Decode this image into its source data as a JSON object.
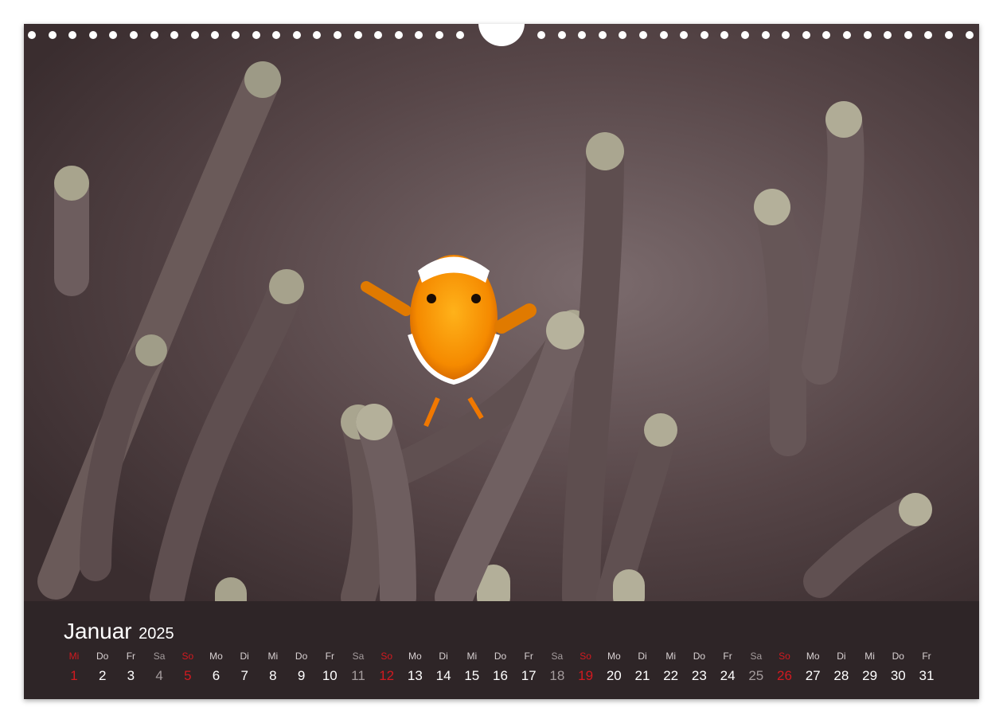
{
  "calendar": {
    "month": "Januar",
    "year": "2025",
    "photo_subject": "clownfish-in-anemone",
    "colors": {
      "bar": "#2e2527",
      "weekday": "#ffffff",
      "saturday": "#a49c9d",
      "sunday": "#d11a20"
    },
    "days": [
      {
        "wd": "Mi",
        "d": "1",
        "type": "sun"
      },
      {
        "wd": "Do",
        "d": "2",
        "type": "wk"
      },
      {
        "wd": "Fr",
        "d": "3",
        "type": "wk"
      },
      {
        "wd": "Sa",
        "d": "4",
        "type": "sat"
      },
      {
        "wd": "So",
        "d": "5",
        "type": "sun"
      },
      {
        "wd": "Mo",
        "d": "6",
        "type": "wk"
      },
      {
        "wd": "Di",
        "d": "7",
        "type": "wk"
      },
      {
        "wd": "Mi",
        "d": "8",
        "type": "wk"
      },
      {
        "wd": "Do",
        "d": "9",
        "type": "wk"
      },
      {
        "wd": "Fr",
        "d": "10",
        "type": "wk"
      },
      {
        "wd": "Sa",
        "d": "11",
        "type": "sat"
      },
      {
        "wd": "So",
        "d": "12",
        "type": "sun"
      },
      {
        "wd": "Mo",
        "d": "13",
        "type": "wk"
      },
      {
        "wd": "Di",
        "d": "14",
        "type": "wk"
      },
      {
        "wd": "Mi",
        "d": "15",
        "type": "wk"
      },
      {
        "wd": "Do",
        "d": "16",
        "type": "wk"
      },
      {
        "wd": "Fr",
        "d": "17",
        "type": "wk"
      },
      {
        "wd": "Sa",
        "d": "18",
        "type": "sat"
      },
      {
        "wd": "So",
        "d": "19",
        "type": "sun"
      },
      {
        "wd": "Mo",
        "d": "20",
        "type": "wk"
      },
      {
        "wd": "Di",
        "d": "21",
        "type": "wk"
      },
      {
        "wd": "Mi",
        "d": "22",
        "type": "wk"
      },
      {
        "wd": "Do",
        "d": "23",
        "type": "wk"
      },
      {
        "wd": "Fr",
        "d": "24",
        "type": "wk"
      },
      {
        "wd": "Sa",
        "d": "25",
        "type": "sat"
      },
      {
        "wd": "So",
        "d": "26",
        "type": "sun"
      },
      {
        "wd": "Mo",
        "d": "27",
        "type": "wk"
      },
      {
        "wd": "Di",
        "d": "28",
        "type": "wk"
      },
      {
        "wd": "Mi",
        "d": "29",
        "type": "wk"
      },
      {
        "wd": "Do",
        "d": "30",
        "type": "wk"
      },
      {
        "wd": "Fr",
        "d": "31",
        "type": "wk"
      }
    ]
  }
}
